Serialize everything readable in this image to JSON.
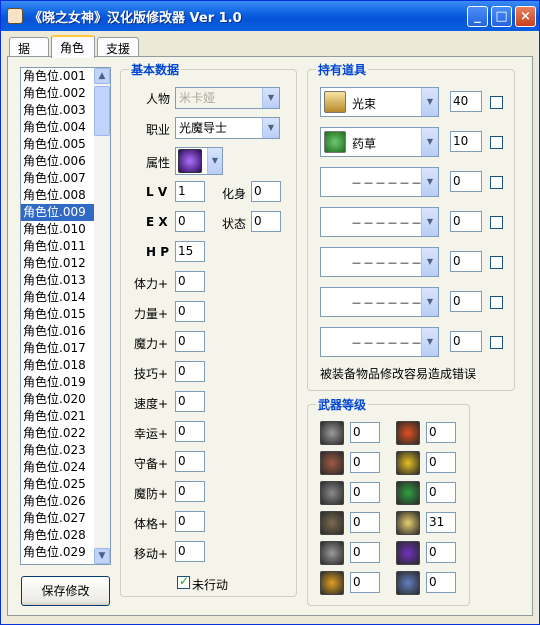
{
  "window": {
    "title": "《晓之女神》汉化版修改器 Ver 1.0",
    "min": "_",
    "max": "□",
    "close": "×"
  },
  "tabs": [
    {
      "label": "据点"
    },
    {
      "label": "角色"
    },
    {
      "label": "支援"
    }
  ],
  "list": {
    "items": [
      "角色位.001",
      "角色位.002",
      "角色位.003",
      "角色位.004",
      "角色位.005",
      "角色位.006",
      "角色位.007",
      "角色位.008",
      "角色位.009",
      "角色位.010",
      "角色位.011",
      "角色位.012",
      "角色位.013",
      "角色位.014",
      "角色位.015",
      "角色位.016",
      "角色位.017",
      "角色位.018",
      "角色位.019",
      "角色位.020",
      "角色位.021",
      "角色位.022",
      "角色位.023",
      "角色位.024",
      "角色位.025",
      "角色位.026",
      "角色位.027",
      "角色位.028",
      "角色位.029"
    ],
    "selected": "角色位.009"
  },
  "save_button": "保存修改",
  "basic": {
    "title": "基本数据",
    "person_label": "人物",
    "person_value": "米卡娅",
    "class_label": "职业",
    "class_value": "光魔导士",
    "attr_label": "属性",
    "lv_label": "L V",
    "lv": "1",
    "transform_label": "化身",
    "transform": "0",
    "ex_label": "E X",
    "ex": "0",
    "status_label": "状态",
    "status": "0",
    "hp_label": "H P",
    "hp": "15",
    "stats": [
      {
        "label": "体力+",
        "value": "0"
      },
      {
        "label": "力量+",
        "value": "0"
      },
      {
        "label": "魔力+",
        "value": "0"
      },
      {
        "label": "技巧+",
        "value": "0"
      },
      {
        "label": "速度+",
        "value": "0"
      },
      {
        "label": "幸运+",
        "value": "0"
      },
      {
        "label": "守备+",
        "value": "0"
      },
      {
        "label": "魔防+",
        "value": "0"
      },
      {
        "label": "体格+",
        "value": "0"
      },
      {
        "label": "移动+",
        "value": "0"
      }
    ],
    "not_acted_label": "未行动"
  },
  "items": {
    "title": "持有道具",
    "slots": [
      {
        "name": "光束",
        "count": "40",
        "icon": "light-tome-icon"
      },
      {
        "name": "药草",
        "count": "10",
        "icon": "herb-leaf-icon"
      },
      {
        "name": "－－－－－－",
        "count": "0"
      },
      {
        "name": "－－－－－－",
        "count": "0"
      },
      {
        "name": "－－－－－－",
        "count": "0"
      },
      {
        "name": "－－－－－－",
        "count": "0"
      },
      {
        "name": "－－－－－－",
        "count": "0"
      }
    ],
    "warning": "被装备物品修改容易造成错误"
  },
  "weapons": {
    "title": "武器等级",
    "left": [
      {
        "icon": "sword-icon",
        "value": "0"
      },
      {
        "icon": "lance-icon",
        "value": "0"
      },
      {
        "icon": "axe-icon",
        "value": "0"
      },
      {
        "icon": "bow-icon",
        "value": "0"
      },
      {
        "icon": "knife-icon",
        "value": "0"
      },
      {
        "icon": "strike-icon",
        "value": "0"
      }
    ],
    "right": [
      {
        "icon": "fire-icon",
        "value": "0"
      },
      {
        "icon": "thunder-icon",
        "value": "0"
      },
      {
        "icon": "wind-icon",
        "value": "0"
      },
      {
        "icon": "light-icon",
        "value": "31"
      },
      {
        "icon": "dark-icon",
        "value": "0"
      },
      {
        "icon": "staff-icon",
        "value": "0"
      }
    ]
  }
}
